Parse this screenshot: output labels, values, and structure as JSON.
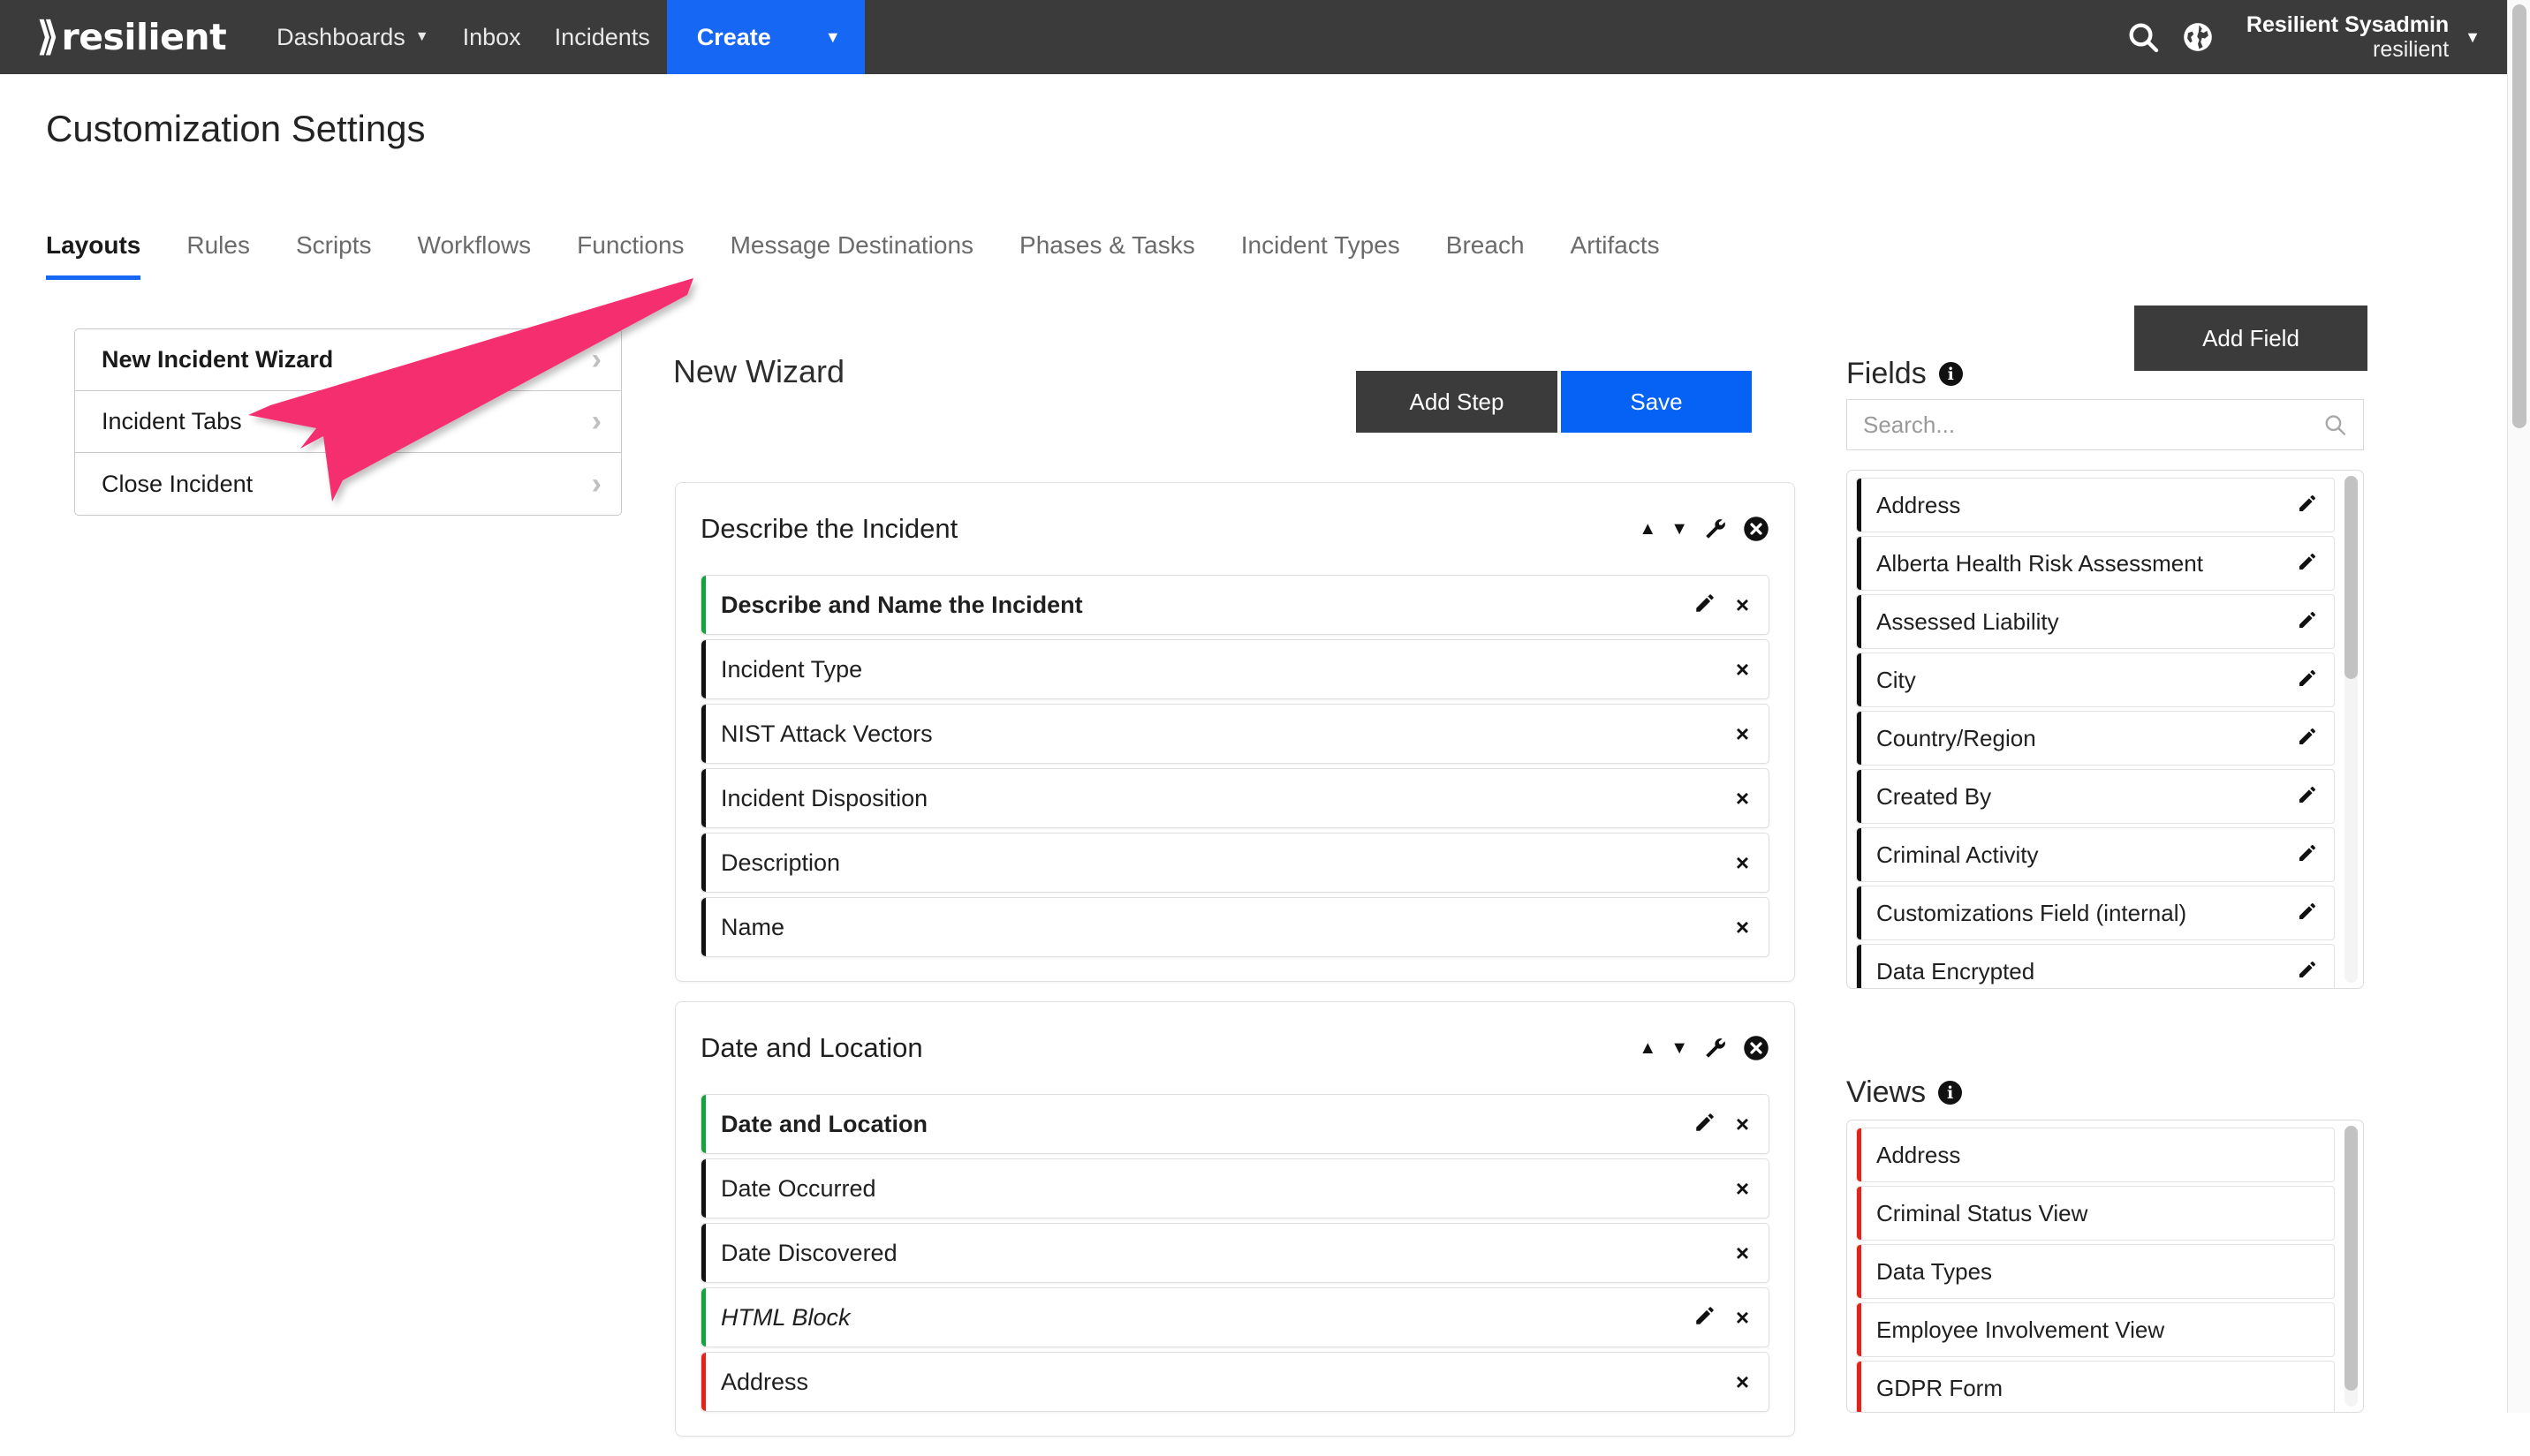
{
  "navbar": {
    "brand_mark": "⟫",
    "brand_text": "resilient",
    "items": [
      {
        "label": "Dashboards",
        "caret": "▼",
        "has_caret": true
      },
      {
        "label": "Inbox",
        "has_caret": false
      },
      {
        "label": "Incidents",
        "has_caret": false
      }
    ],
    "create_label": "Create",
    "create_caret": "▼",
    "search_icon": "search-icon",
    "globe_icon": "globe-icon",
    "user_name": "Resilient Sysadmin",
    "user_org": "resilient",
    "user_caret": "▼"
  },
  "page": {
    "title": "Customization Settings"
  },
  "tabs": [
    {
      "label": "Layouts",
      "active": true
    },
    {
      "label": "Rules",
      "active": false
    },
    {
      "label": "Scripts",
      "active": false
    },
    {
      "label": "Workflows",
      "active": false
    },
    {
      "label": "Functions",
      "active": false
    },
    {
      "label": "Message Destinations",
      "active": false
    },
    {
      "label": "Phases & Tasks",
      "active": false
    },
    {
      "label": "Incident Types",
      "active": false
    },
    {
      "label": "Breach",
      "active": false
    },
    {
      "label": "Artifacts",
      "active": false
    }
  ],
  "layout_list": [
    {
      "label": "New Incident Wizard",
      "selected": true,
      "chevron": "›"
    },
    {
      "label": "Incident Tabs",
      "selected": false,
      "chevron": "›"
    },
    {
      "label": "Close Incident",
      "selected": false,
      "chevron": "›"
    }
  ],
  "wizard": {
    "title": "New Wizard",
    "add_step_label": "Add Step",
    "save_label": "Save"
  },
  "sections": [
    {
      "title": "Describe the Incident",
      "tools": {
        "up": "▲",
        "down": "▼",
        "wrench": "🔧",
        "close": "✖"
      },
      "rows": [
        {
          "label": "Describe and Name the Incident",
          "accent": "green",
          "bold": true,
          "italic": false,
          "pencil": true,
          "close": "×"
        },
        {
          "label": "Incident Type",
          "accent": "dark",
          "bold": false,
          "italic": false,
          "pencil": false,
          "close": "×"
        },
        {
          "label": "NIST Attack Vectors",
          "accent": "dark",
          "bold": false,
          "italic": false,
          "pencil": false,
          "close": "×"
        },
        {
          "label": "Incident Disposition",
          "accent": "dark",
          "bold": false,
          "italic": false,
          "pencil": false,
          "close": "×"
        },
        {
          "label": "Description",
          "accent": "dark",
          "bold": false,
          "italic": false,
          "pencil": false,
          "close": "×"
        },
        {
          "label": "Name",
          "accent": "dark",
          "bold": false,
          "italic": false,
          "pencil": false,
          "close": "×"
        }
      ]
    },
    {
      "title": "Date and Location",
      "tools": {
        "up": "▲",
        "down": "▼",
        "wrench": "🔧",
        "close": "✖"
      },
      "rows": [
        {
          "label": "Date and Location",
          "accent": "green",
          "bold": true,
          "italic": false,
          "pencil": true,
          "close": "×"
        },
        {
          "label": "Date Occurred",
          "accent": "dark",
          "bold": false,
          "italic": false,
          "pencil": false,
          "close": "×"
        },
        {
          "label": "Date Discovered",
          "accent": "dark",
          "bold": false,
          "italic": false,
          "pencil": false,
          "close": "×"
        },
        {
          "label": "HTML Block",
          "accent": "green",
          "bold": false,
          "italic": true,
          "pencil": true,
          "close": "×"
        },
        {
          "label": "Address",
          "accent": "red",
          "bold": false,
          "italic": false,
          "pencil": false,
          "close": "×"
        }
      ]
    }
  ],
  "fields_panel": {
    "heading": "Fields",
    "info": "i",
    "add_field_label": "Add Field",
    "search_placeholder": "Search...",
    "search_value": "",
    "search_icon": "search-icon",
    "items": [
      {
        "label": "Address",
        "accent": "dark",
        "pencil": "✎"
      },
      {
        "label": "Alberta Health Risk Assessment",
        "accent": "dark",
        "pencil": "✎"
      },
      {
        "label": "Assessed Liability",
        "accent": "dark",
        "pencil": "✎"
      },
      {
        "label": "City",
        "accent": "dark",
        "pencil": "✎"
      },
      {
        "label": "Country/Region",
        "accent": "dark",
        "pencil": "✎"
      },
      {
        "label": "Created By",
        "accent": "dark",
        "pencil": "✎"
      },
      {
        "label": "Criminal Activity",
        "accent": "dark",
        "pencil": "✎"
      },
      {
        "label": "Customizations Field (internal)",
        "accent": "dark",
        "pencil": "✎"
      },
      {
        "label": "Data Encrypted",
        "accent": "dark",
        "pencil": "✎"
      }
    ]
  },
  "views_panel": {
    "heading": "Views",
    "info": "i",
    "items": [
      {
        "label": "Address",
        "accent": "red"
      },
      {
        "label": "Criminal Status View",
        "accent": "red"
      },
      {
        "label": "Data Types",
        "accent": "red"
      },
      {
        "label": "Employee Involvement View",
        "accent": "red"
      },
      {
        "label": "GDPR Form",
        "accent": "red"
      }
    ]
  },
  "annotation": {
    "arrow_color": "#f52f70",
    "points_to": "Close Incident"
  }
}
